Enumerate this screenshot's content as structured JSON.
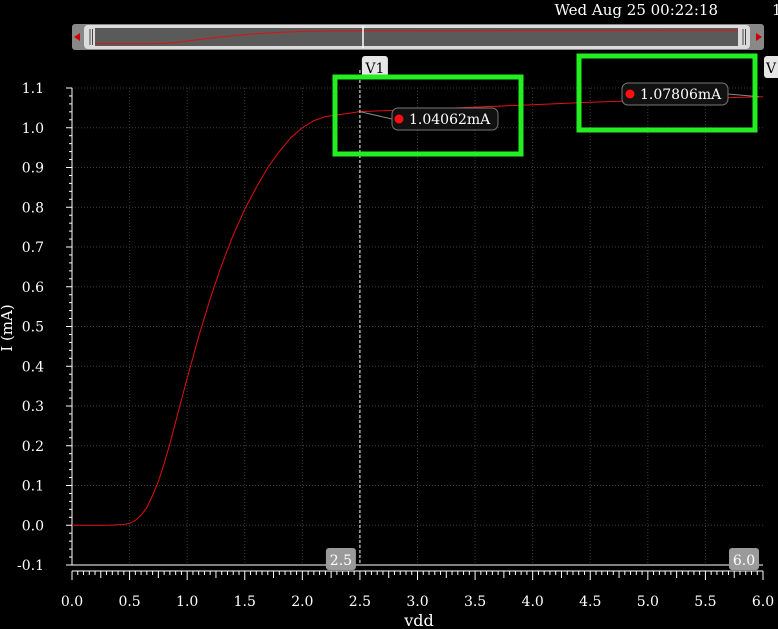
{
  "header": {
    "timestamp": "Wed Aug 25 00:22:18",
    "page_number": "1"
  },
  "colors": {
    "background": "#000000",
    "curve": "#e01010",
    "highlight": "#22ee22",
    "grid": "#3c3c3c"
  },
  "chart_data": {
    "type": "line",
    "xlabel": "vdd",
    "ylabel": "I (mA)",
    "xlim": [
      0.0,
      6.0
    ],
    "ylim": [
      -0.1,
      1.1
    ],
    "xticks": [
      "0.0",
      "0.5",
      "1.0",
      "1.5",
      "2.0",
      "2.5",
      "3.0",
      "3.5",
      "4.0",
      "4.5",
      "5.0",
      "5.5",
      "6.0"
    ],
    "yticks": [
      "1.1",
      "1.0",
      "0.9",
      "0.8",
      "0.7",
      "0.6",
      "0.5",
      "0.4",
      "0.3",
      "0.2",
      "0.1",
      "0.0",
      "-0.1"
    ],
    "grid": true,
    "series": [
      {
        "x": [
          0.0,
          0.3,
          0.45,
          0.5,
          0.55,
          0.6,
          0.65,
          0.7,
          0.75,
          0.8,
          0.85,
          0.9,
          0.95,
          1.0,
          1.1,
          1.2,
          1.3,
          1.4,
          1.5,
          1.6,
          1.7,
          1.8,
          1.9,
          2.0,
          2.1,
          2.2,
          2.3,
          2.5,
          3.0,
          3.5,
          4.0,
          4.5,
          5.0,
          5.5,
          6.0
        ],
        "y": [
          0.0,
          0.0,
          0.002,
          0.005,
          0.012,
          0.025,
          0.045,
          0.075,
          0.11,
          0.155,
          0.205,
          0.26,
          0.315,
          0.37,
          0.475,
          0.57,
          0.655,
          0.73,
          0.795,
          0.85,
          0.9,
          0.94,
          0.975,
          1.0,
          1.018,
          1.028,
          1.032,
          1.0406,
          1.046,
          1.052,
          1.058,
          1.064,
          1.069,
          1.074,
          1.078
        ]
      }
    ],
    "markers": [
      {
        "name": "V1",
        "x": 2.5,
        "x_label": "2.5",
        "value_label": "1.04062mA",
        "y": 1.04062
      },
      {
        "name": "V",
        "x": 6.0,
        "x_label": "6.0",
        "value_label": "1.07806mA",
        "y": 1.07806
      }
    ]
  }
}
